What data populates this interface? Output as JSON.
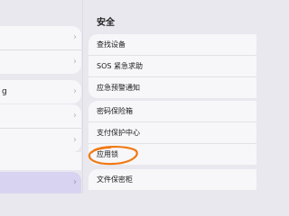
{
  "right": {
    "section_title": "安全",
    "groups": [
      {
        "items": [
          {
            "label": "查找设备"
          },
          {
            "label": "SOS 紧急求助"
          },
          {
            "label": "应急预警通知"
          }
        ]
      },
      {
        "items": [
          {
            "label": "密码保险箱"
          },
          {
            "label": "支付保护中心"
          },
          {
            "label": "应用锁"
          }
        ]
      },
      {
        "items": [
          {
            "label": "文件保密柜"
          }
        ]
      }
    ]
  },
  "left": {
    "row_prefix_glyph": "g",
    "chevron": "›"
  },
  "colors": {
    "background": "#e9e8ef",
    "row_background": "#f7f7f9",
    "selected_row": "#d8d3f0",
    "annotation_circle": "#f07a14"
  },
  "icons": {
    "chevron": "chevron-right-icon",
    "annotation": "hand-drawn-orange-circle"
  }
}
